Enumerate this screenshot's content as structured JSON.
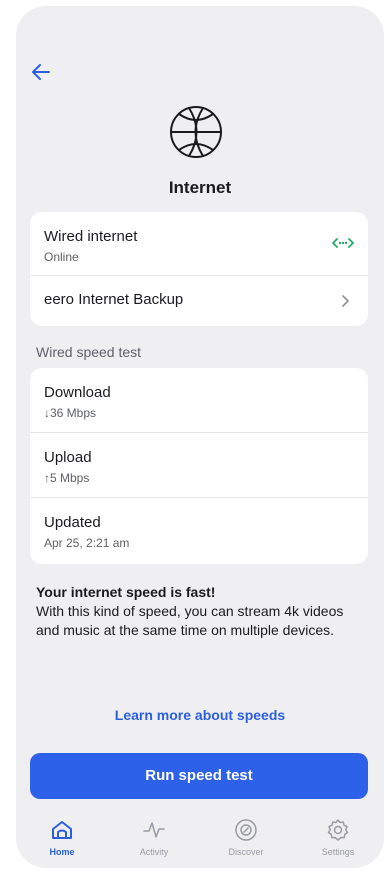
{
  "header": {
    "title": "Internet"
  },
  "status": {
    "wired_title": "Wired internet",
    "wired_status": "Online",
    "backup_label": "eero Internet Backup"
  },
  "speed_section": {
    "label": "Wired speed test",
    "download_title": "Download",
    "download_value": "↓36 Mbps",
    "upload_title": "Upload",
    "upload_value": "↑5 Mbps",
    "updated_title": "Updated",
    "updated_value": "Apr 25, 2:21 am"
  },
  "description": {
    "title": "Your internet speed is fast!",
    "body": "With this kind of speed, you can stream 4k videos and music at the same time on multiple devices."
  },
  "learn_more_label": "Learn more about speeds",
  "run_button_label": "Run speed test",
  "tabs": [
    {
      "label": "Home",
      "icon": "home-icon",
      "active": true
    },
    {
      "label": "Activity",
      "icon": "activity-icon",
      "active": false
    },
    {
      "label": "Discover",
      "icon": "compass-icon",
      "active": false
    },
    {
      "label": "Settings",
      "icon": "gear-icon",
      "active": false
    }
  ],
  "colors": {
    "accent": "#2e61ea",
    "online_green": "#27a86a",
    "background": "#efeff2"
  }
}
